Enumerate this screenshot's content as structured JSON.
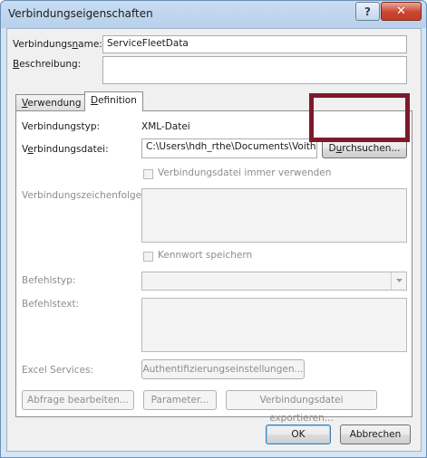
{
  "window": {
    "title": "Verbindungseigenschaften",
    "help_glyph": "?",
    "close_glyph": "✕"
  },
  "fields": {
    "name_label_pre": "Verbindungs",
    "name_label_ul": "n",
    "name_label_post": "ame:",
    "name_value": "ServiceFleetData",
    "desc_label_ul": "B",
    "desc_label_post": "eschreibung:",
    "desc_value": ""
  },
  "tabs": [
    {
      "label_ul": "V",
      "label_post": "erwendung"
    },
    {
      "label_ul": "D",
      "label_post": "efinition"
    }
  ],
  "definition": {
    "type_label": "Verbindungstyp:",
    "type_value": "XML-Datei",
    "file_label_pre": "V",
    "file_label_ul": "e",
    "file_label_post": "rbindungsdatei:",
    "file_value": "C:\\Users\\hdh_rthe\\Documents\\VoithDia",
    "browse_pre": "D",
    "browse_ul": "u",
    "browse_post": "rchsuchen...",
    "always_use_label": "Verbindungsdatei immer verwenden",
    "conn_string_label": "Verbindungszeichenfolge:",
    "save_pw_label": "Kennwort speichern",
    "cmd_type_label": "Befehlstyp:",
    "cmd_text_label": "Befehlstext:",
    "excel_label": "Excel Services:",
    "auth_button": "Authentifizierungseinstellungen...",
    "edit_query_button": "Abfrage bearbeiten...",
    "params_button": "Parameter...",
    "export_button": "Verbindungsdatei exportieren..."
  },
  "footer": {
    "ok": "OK",
    "cancel": "Abbrechen"
  }
}
